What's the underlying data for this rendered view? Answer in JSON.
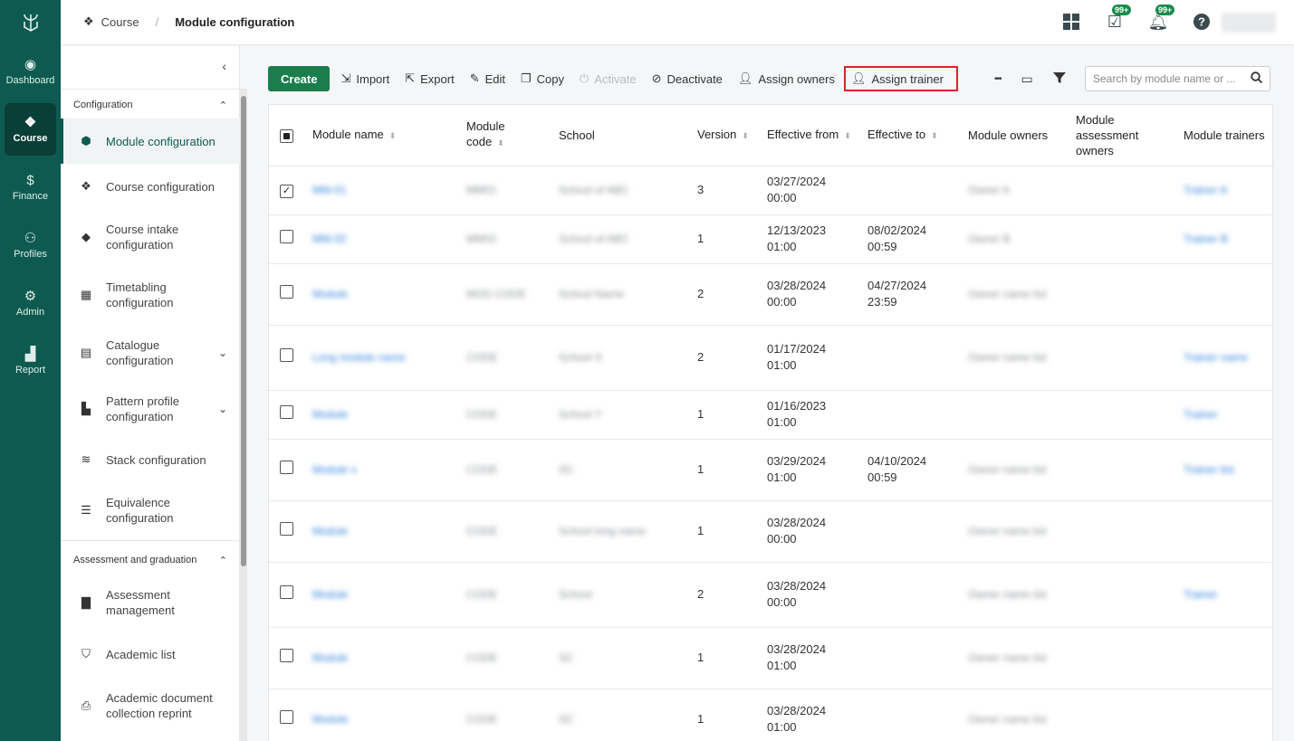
{
  "rail": {
    "items": [
      {
        "label": "Dashboard",
        "icon": "compass-icon"
      },
      {
        "label": "Course",
        "icon": "cubes-icon"
      },
      {
        "label": "Finance",
        "icon": "dollar-icon"
      },
      {
        "label": "Profiles",
        "icon": "users-icon"
      },
      {
        "label": "Admin",
        "icon": "user-gear-icon"
      },
      {
        "label": "Report",
        "icon": "chart-icon"
      }
    ]
  },
  "breadcrumb": {
    "parent": "Course",
    "sep": "/",
    "current": "Module configuration"
  },
  "header": {
    "tasks_badge": "99+",
    "notif_badge": "99+"
  },
  "sidebar": {
    "section1": "Configuration",
    "items1": [
      {
        "label": "Module configuration"
      },
      {
        "label": "Course configuration"
      },
      {
        "label": "Course intake configuration"
      },
      {
        "label": "Timetabling configuration"
      },
      {
        "label": "Catalogue configuration"
      },
      {
        "label": "Pattern profile configuration"
      },
      {
        "label": "Stack configuration"
      },
      {
        "label": "Equivalence configuration"
      }
    ],
    "section2": "Assessment and graduation",
    "items2": [
      {
        "label": "Assessment management"
      },
      {
        "label": "Academic list"
      },
      {
        "label": "Academic document collection reprint"
      }
    ]
  },
  "toolbar": {
    "create": "Create",
    "import": "Import",
    "export": "Export",
    "edit": "Edit",
    "copy": "Copy",
    "activate": "Activate",
    "deactivate": "Deactivate",
    "assign_owners": "Assign owners",
    "assign_trainer": "Assign trainer",
    "more": "•••"
  },
  "search": {
    "placeholder": "Search by module name or ..."
  },
  "table": {
    "columns": [
      "Module name",
      "Module code",
      "School",
      "Version",
      "Effective from",
      "Effective to",
      "Module owners",
      "Module assessment owners",
      "Module trainers"
    ],
    "rows": [
      {
        "name": "MM-01",
        "code": "MM01",
        "school": "School of ABC",
        "version": "3",
        "from_date": "03/27/2024",
        "from_time": "00:00",
        "to_date": "",
        "to_time": "",
        "owners": "Owner A",
        "trainers": "Trainer A",
        "checked": true
      },
      {
        "name": "MM-02",
        "code": "MM02",
        "school": "School of ABC",
        "version": "1",
        "from_date": "12/13/2023",
        "from_time": "01:00",
        "to_date": "08/02/2024",
        "to_time": "00:59",
        "owners": "Owner B",
        "trainers": "Trainer B",
        "checked": false
      },
      {
        "name": "Module",
        "code": "MOD CODE",
        "school": "School Name",
        "version": "2",
        "from_date": "03/28/2024",
        "from_time": "00:00",
        "to_date": "04/27/2024",
        "to_time": "23:59",
        "owners": "Owner name list",
        "trainers": "",
        "checked": false
      },
      {
        "name": "Long module name",
        "code": "CODE",
        "school": "School X",
        "version": "2",
        "from_date": "01/17/2024",
        "from_time": "01:00",
        "to_date": "",
        "to_time": "",
        "owners": "Owner name list",
        "trainers": "Trainer name",
        "checked": false
      },
      {
        "name": "Module",
        "code": "CODE",
        "school": "School Y",
        "version": "1",
        "from_date": "01/16/2023",
        "from_time": "01:00",
        "to_date": "",
        "to_time": "",
        "owners": "",
        "trainers": "Trainer",
        "checked": false
      },
      {
        "name": "Module x",
        "code": "CODE",
        "school": "SC",
        "version": "1",
        "from_date": "03/29/2024",
        "from_time": "01:00",
        "to_date": "04/10/2024",
        "to_time": "00:59",
        "owners": "Owner name list",
        "trainers": "Trainer list",
        "checked": false
      },
      {
        "name": "Module",
        "code": "CODE",
        "school": "School long name",
        "version": "1",
        "from_date": "03/28/2024",
        "from_time": "00:00",
        "to_date": "",
        "to_time": "",
        "owners": "Owner name list",
        "trainers": "",
        "checked": false
      },
      {
        "name": "Module",
        "code": "CODE",
        "school": "School",
        "version": "2",
        "from_date": "03/28/2024",
        "from_time": "00:00",
        "to_date": "",
        "to_time": "",
        "owners": "Owner name list",
        "trainers": "Trainer",
        "checked": false
      },
      {
        "name": "Module",
        "code": "CODE",
        "school": "SC",
        "version": "1",
        "from_date": "03/28/2024",
        "from_time": "01:00",
        "to_date": "",
        "to_time": "",
        "owners": "Owner name list",
        "trainers": "",
        "checked": false
      },
      {
        "name": "Module",
        "code": "CODE",
        "school": "SC",
        "version": "1",
        "from_date": "03/28/2024",
        "from_time": "01:00",
        "to_date": "",
        "to_time": "",
        "owners": "Owner name list",
        "trainers": "",
        "checked": false
      }
    ]
  }
}
